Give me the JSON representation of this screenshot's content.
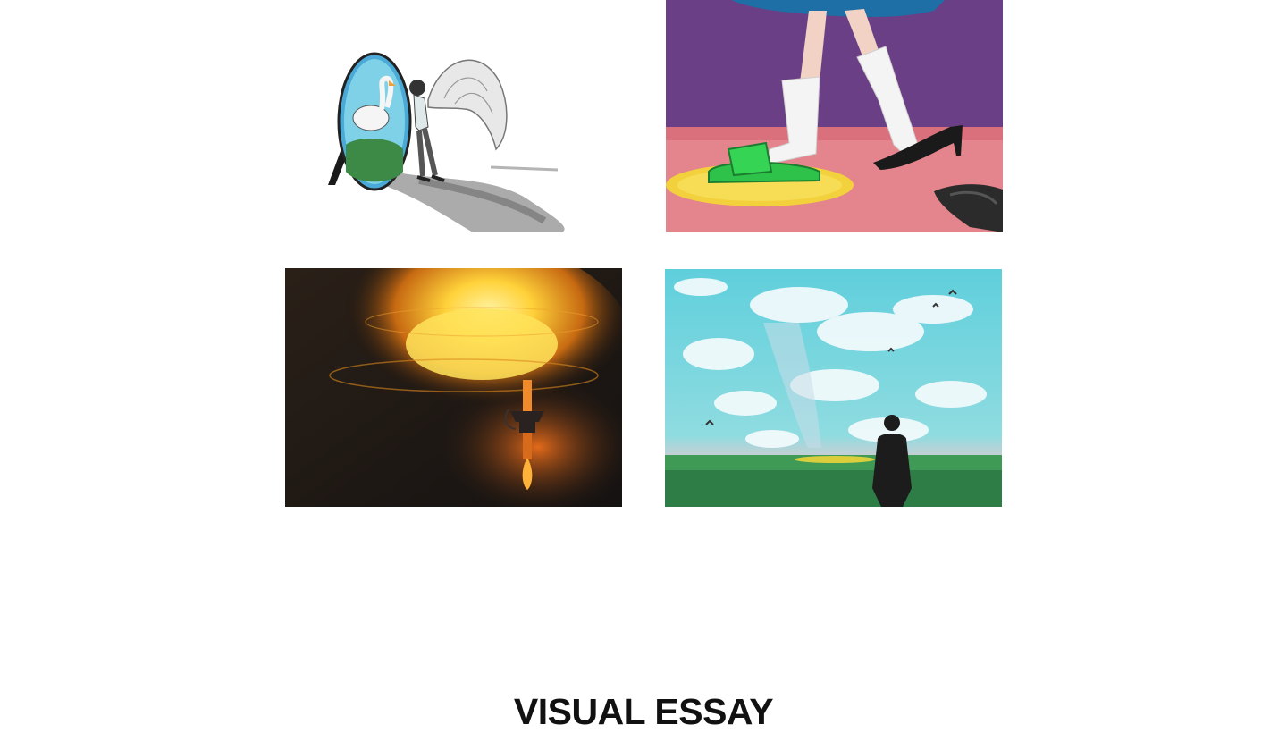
{
  "section": {
    "title": "VISUAL ESSAY"
  },
  "gallery": {
    "items": [
      {
        "icon": "angel-mirror-swan-illustration"
      },
      {
        "icon": "feet-slippers-heels-illustration"
      },
      {
        "icon": "flaming-torch-illustration"
      },
      {
        "icon": "silhouette-sky-clouds-illustration"
      }
    ]
  },
  "colors": {
    "background": "#ffffff",
    "title_text": "#111111",
    "purple_wall": "#6b3f86",
    "pink_floor": "#d9707c",
    "slipper_green": "#2ec24a",
    "sky_cyan": "#5fcfdc",
    "grass_green": "#3f9a55",
    "fire_yellow": "#ffd23a"
  }
}
